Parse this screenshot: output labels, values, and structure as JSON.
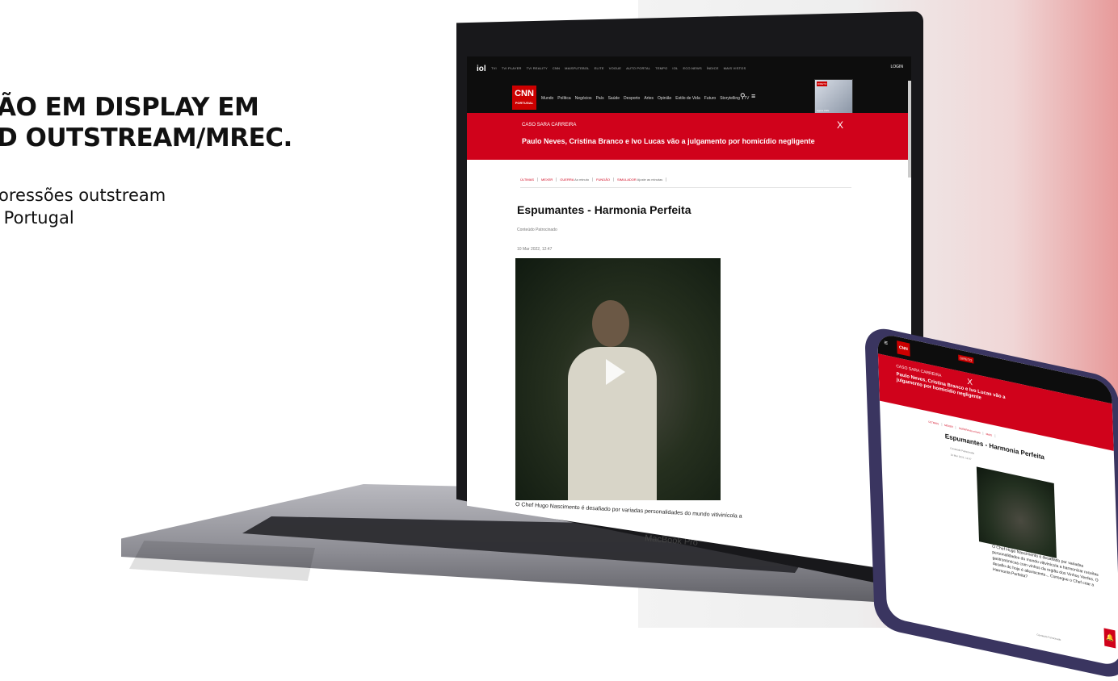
{
  "hero": {
    "headline_line1": "ÃO EM DISPLAY EM",
    "headline_line2": "D OUTSTREAM/MREC.",
    "sub_line1": "oressões outstream",
    "sub_line2": " Portugal"
  },
  "laptop": {
    "brand": "MacBook Pro",
    "site": {
      "top_logo": "iol",
      "top_nav": [
        "TVI",
        "TVI PLAYER",
        "TVI REALITY",
        "CNN",
        "MAISFUTEBOL",
        "ELITE",
        "VOGUE",
        "AUTO PORTAL",
        "TEMPO",
        "IOL",
        "ECO.NEWS",
        "ÍNDICE",
        "MAIS VISTOS"
      ],
      "login": "LOGIN",
      "logo": "CNN",
      "logo_sub": "PORTUGAL",
      "main_nav": [
        "Mundo",
        "Política",
        "Negócios",
        "País",
        "Saúde",
        "Desporto",
        "Artes",
        "Opinião",
        "Estilo de Vida",
        "Futuro",
        "Storytelling",
        "TV"
      ],
      "search_icon": "search-icon",
      "menu_icon": "menu-icon",
      "live_badge": "DIRETO",
      "live_caption": "Agora CNN",
      "breaking_label": "CASO SARA CARREIRA",
      "breaking_title": "Paulo Neves, Cristina Branco e Ivo Lucas vão a julgamento por homicídio negligente",
      "breaking_close": "X",
      "tags": [
        {
          "label": "ÚLTIMAS"
        },
        {
          "label": "MEXER"
        },
        {
          "label": "GUERRA",
          "extra": "Ao minuto"
        },
        {
          "label": "FUNDÃO"
        },
        {
          "label": "SIMULADOR",
          "extra": "Ajuste as minutas"
        }
      ],
      "article_title": "Espumantes - Harmonia Perfeita",
      "sponsored": "Conteúdo Patrocinado",
      "date": "10 Mar 2022, 12:47",
      "caption": "O Chef Hugo Nascimento é desafiado por variadas personalidades do mundo vitivinícola a"
    }
  },
  "phone": {
    "logo": "CNN",
    "live_badge": "DIRETO",
    "breaking_label": "CASO SARA CARREIRA",
    "breaking_title": "Paulo Neves, Cristina Branco e Ivo Lucas vão a julgamento por homicídio negligente",
    "close": "X",
    "tags": [
      "ÚLTIMAS",
      "MEXER",
      "GUERRA Ao minuto",
      "MAIS"
    ],
    "article_title": "Espumantes - Harmonia Perfeita",
    "sponsored": "Conteúdo Patrocinado",
    "date": "10 Mar 2022, 12:47",
    "body": "O Chef Hugo Nascimento é desafiado por variadas personalidades do mundo vitivinícola a harmonizar receitas gastronómicas com vinhos da região dos Vinhos Verdes. O desafio de hoje é alleviscente... Consegue o Chef criar a Harmonia Perfeita?",
    "footer": "Conteúdo Patrocinado"
  },
  "colors": {
    "brand_red": "#d0021b",
    "dark_bar": "#0d0d0d",
    "phone_frame": "#3a3560"
  }
}
